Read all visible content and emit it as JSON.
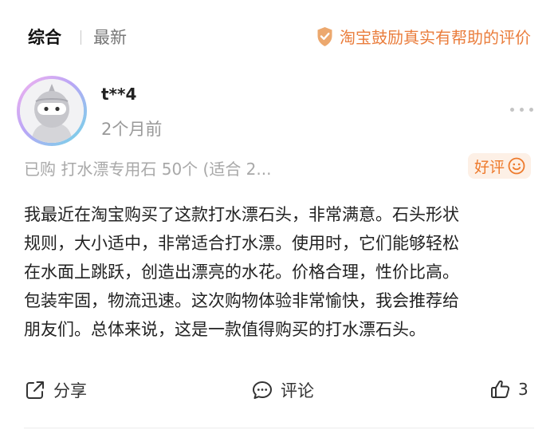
{
  "sort_tabs": {
    "active_label": "综合",
    "other_label": "最新"
  },
  "notice": {
    "text": "淘宝鼓励真实有帮助的评价",
    "icon": "verified-shield-icon",
    "color": "#ea7d3c"
  },
  "review": {
    "avatar_icon": "ninja-avatar",
    "username": "t**4",
    "post_time": "2个月前",
    "more_icon": "more-dots-icon",
    "purchase_info": "已购 打水漂专用石 50个 (适合 2...",
    "rating_label": "好评",
    "rating_icon": "smile-icon",
    "rating_color": "#ee7a2c",
    "lines": [
      "我最近在淘宝购买了这款打水漂石头，非常满意。石头形状",
      "规则，大小适中，非常适合打水漂。使用时，它们能够轻松",
      "在水面上跳跃，创造出漂亮的水花。价格合理，性价比高。",
      "包装牢固，物流迅速。这次购物体验非常愉快，我会推荐给",
      "朋友们。总体来说，这是一款值得购买的打水漂石头。"
    ]
  },
  "actions": {
    "share_label": "分享",
    "share_icon": "share-icon",
    "comment_label": "评论",
    "comment_icon": "comment-icon",
    "like_icon": "thumbs-up-icon",
    "like_count": "3"
  }
}
